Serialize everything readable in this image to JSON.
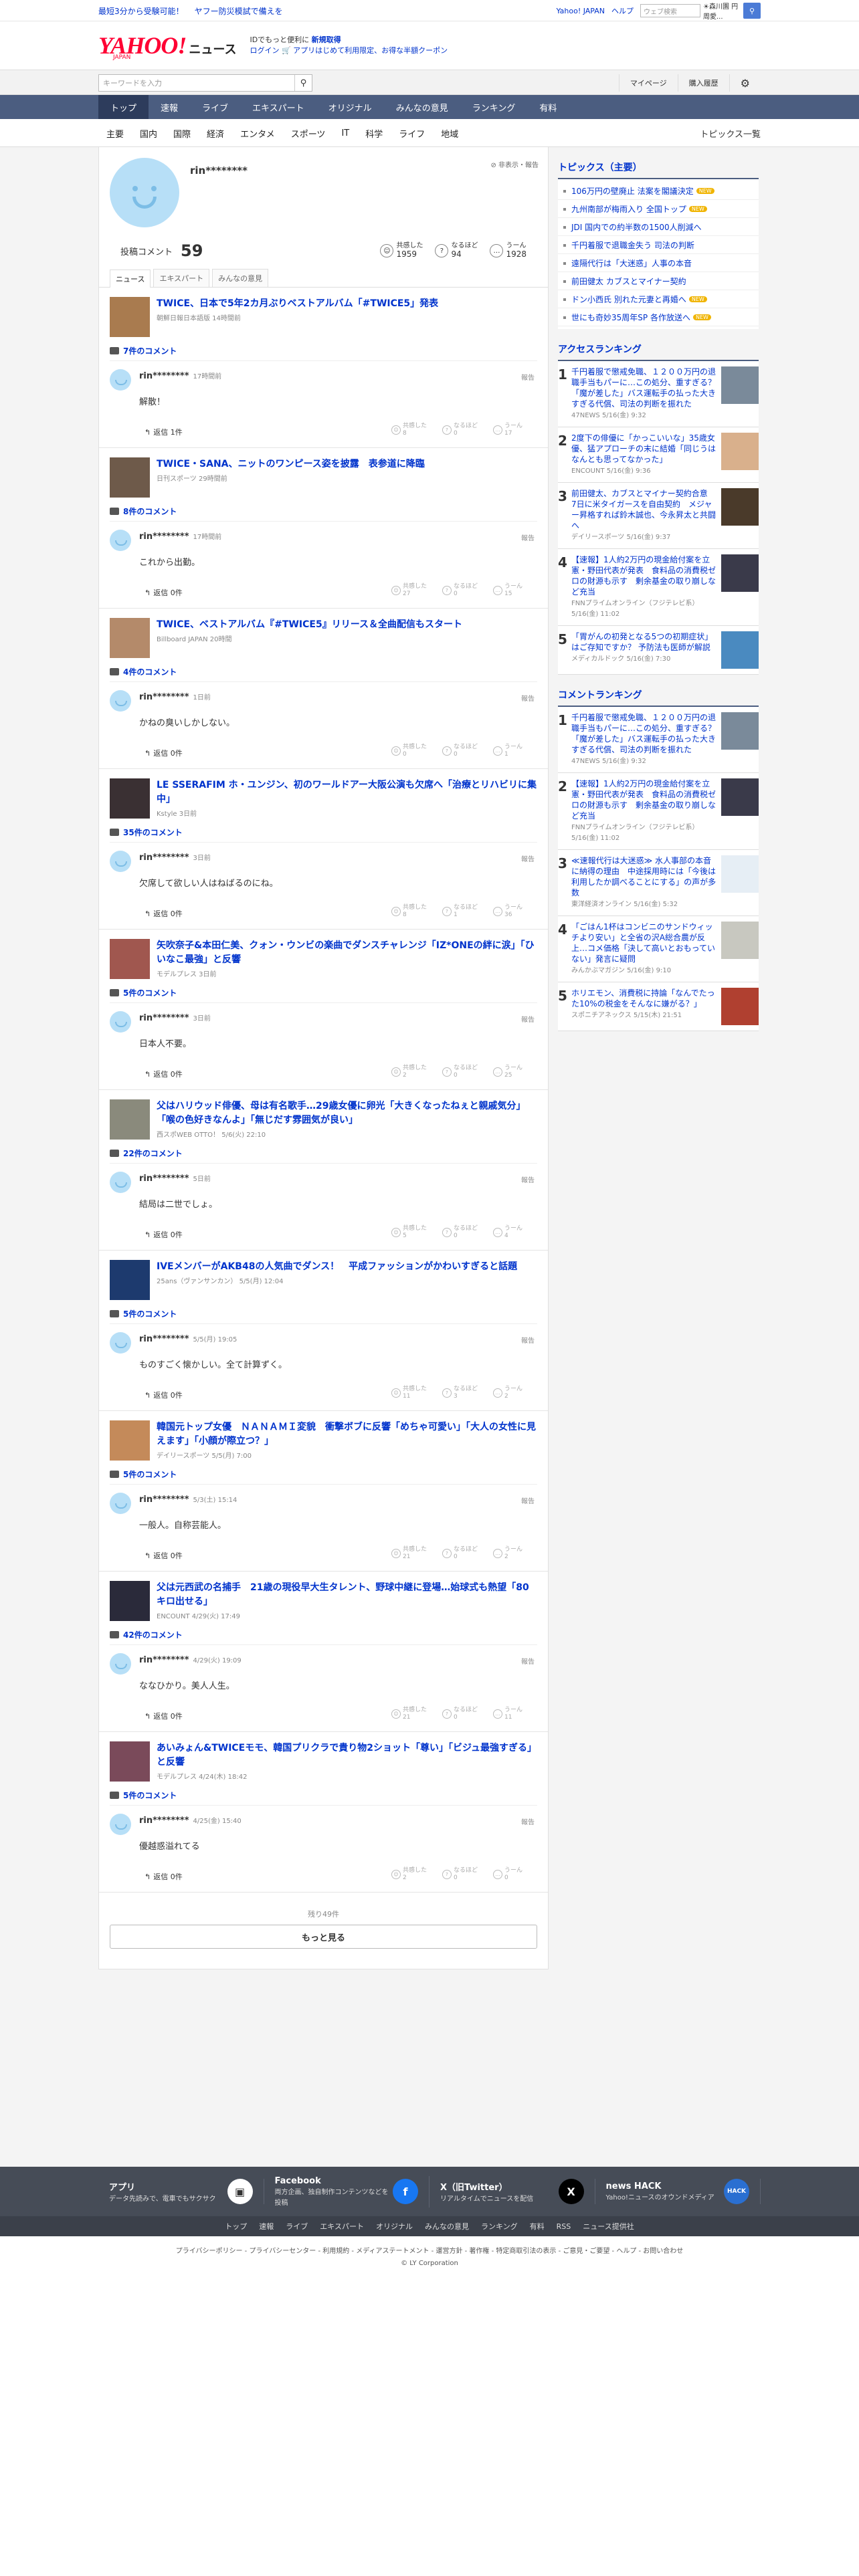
{
  "promo": {
    "left1": "最短3分から受験可能！",
    "left2": "ヤフー防災模試で備えを",
    "links": [
      "Yahoo! JAPAN",
      "ヘルプ"
    ],
    "search_placeholder": "ウェブ検索",
    "location": "☀森川園 円周愛...",
    "search_icon": "search-icon"
  },
  "header": {
    "logo": "YAHOO!",
    "logo_sub": "JAPAN",
    "section": "ニュース",
    "line1_pre": "IDでもっと便利に",
    "line1_link": "新規取得",
    "line2": "ログイン 🛒 アプリはじめて利用限定、お得な半額クーポン"
  },
  "search": {
    "placeholder": "キーワードを入力",
    "mypage": "マイページ",
    "history": "購入履歴"
  },
  "nav": {
    "items": [
      "トップ",
      "速報",
      "ライブ",
      "エキスパート",
      "オリジナル",
      "みんなの意見",
      "ランキング",
      "有料"
    ]
  },
  "subnav": {
    "items": [
      "主要",
      "国内",
      "国際",
      "経済",
      "エンタメ",
      "スポーツ",
      "IT",
      "科学",
      "ライフ",
      "地域"
    ],
    "more": "トピックス一覧"
  },
  "profile": {
    "name": "rin********",
    "hide": "非表示・報告",
    "posts_label": "投稿コメント",
    "posts": "59",
    "reactions": [
      {
        "label": "共感した",
        "count": "1959"
      },
      {
        "label": "なるほど",
        "count": "94"
      },
      {
        "label": "うーん",
        "count": "1928"
      }
    ],
    "tabs": [
      "ニュース",
      "エキスパート",
      "みんなの意見"
    ]
  },
  "comments": [
    {
      "title": "TWICE、日本で5年2カ月ぶりベストアルバム「#TWICE5」発表",
      "source": "朝鮮日報日本語版 14時間前",
      "count": "7件のコメント",
      "time": "17時間前",
      "body": "解散！",
      "replies": "返信 1件",
      "r1": "8",
      "r2": "0",
      "r3": "17",
      "thumb": "#a97b4f"
    },
    {
      "title": "TWICE・SANA、ニットのワンピース姿を披露　表参道に降臨",
      "source": "日刊スポーツ 29時間前",
      "count": "8件のコメント",
      "time": "17時間前",
      "body": "これから出勤。",
      "replies": "返信 0件",
      "r1": "27",
      "r2": "0",
      "r3": "15",
      "thumb": "#6e5a4a"
    },
    {
      "title": "TWICE、ベストアルバム『#TWICE5』リリース＆全曲配信もスタート",
      "source": "Billboard JAPAN 20時間",
      "count": "4件のコメント",
      "time": "1日前",
      "body": "かねの臭いしかしない。",
      "replies": "返信 0件",
      "r1": "0",
      "r2": "0",
      "r3": "1",
      "thumb": "#b48a6a"
    },
    {
      "title": "LE SSERAFIM ホ・ユンジン、初のワールドアー大阪公演も欠席へ「治療とリハビリに集中」",
      "source": "Kstyle 3日前",
      "count": "35件のコメント",
      "time": "3日前",
      "body": "欠席して欲しい人はねばるのにね。",
      "replies": "返信 0件",
      "r1": "8",
      "r2": "1",
      "r3": "36",
      "thumb": "#3a3033"
    },
    {
      "title": "矢吹奈子&本田仁美、クォン・ウンビの楽曲でダンスチャレンジ「IZ*ONEの絆に涙」「ひいなこ最強」と反響",
      "source": "モデルプレス 3日前",
      "count": "5件のコメント",
      "time": "3日前",
      "body": "日本人不要。",
      "replies": "返信 0件",
      "r1": "2",
      "r2": "0",
      "r3": "25",
      "thumb": "#a0574f"
    },
    {
      "title": "父はハリウッド俳優、母は有名歌手…29歳女優に卵光「大きくなったねぇと親戚気分」「喉の色好きなんよ」「無じだす雰囲気が良い」",
      "source": "西スポWEB OTTO！ 5/6(火) 22:10",
      "count": "22件のコメント",
      "time": "5日前",
      "body": "結局は二世でしょ。",
      "replies": "返信 0件",
      "r1": "5",
      "r2": "0",
      "r3": "4",
      "thumb": "#8a8a7c"
    },
    {
      "title": "IVEメンバーがAKB48の人気曲でダンス！　平成ファッションがかわいすぎると話題",
      "source": "25ans（ヴァンサンカン） 5/5(月) 12:04",
      "count": "5件のコメント",
      "time": "5/5(月) 19:05",
      "body": "ものすごく懐かしい。全て計算ずく。",
      "replies": "返信 0件",
      "r1": "11",
      "r2": "3",
      "r3": "2",
      "thumb": "#1d3a6e"
    },
    {
      "title": "韓国元トップ女優　ＮＡＮＡＭＩ変貌　衝撃ボブに反響「めちゃ可愛い」「大人の女性に見えます」「小顔が際立つ？」",
      "source": "デイリースポーツ 5/5(月) 7:00",
      "count": "5件のコメント",
      "time": "5/3(土) 15:14",
      "body": "一般人。自称芸能人。",
      "replies": "返信 0件",
      "r1": "21",
      "r2": "0",
      "r3": "2",
      "thumb": "#c48a5a"
    },
    {
      "title": "父は元西武の名捕手　21歳の現役早大生タレント、野球中継に登場…始球式も熱望「80キロ出せる」",
      "source": "ENCOUNT 4/29(火) 17:49",
      "count": "42件のコメント",
      "time": "4/29(火) 19:09",
      "body": "ななひかり。美人人生。",
      "replies": "返信 0件",
      "r1": "21",
      "r2": "0",
      "r3": "11",
      "thumb": "#2a2a3a"
    },
    {
      "title": "あいみょん&TWICEモモ、韓国プリクラで貴り物2ショット「尊い」「ビジュ最強すぎる」と反響",
      "source": "モデルプレス 4/24(木) 18:42",
      "count": "5件のコメント",
      "time": "4/25(金) 15:40",
      "body": "優越惑溢れてる",
      "replies": "返信 0件",
      "r1": "2",
      "r2": "0",
      "r3": "0",
      "thumb": "#7a4a5a"
    }
  ],
  "more": {
    "remaining": "残り49件",
    "button": "もっと見る"
  },
  "sidebar": {
    "topics_title": "トピックス（主要）",
    "topics": [
      {
        "t": "106万円の壁廃止 法案を閣議決定",
        "new": "NEW"
      },
      {
        "t": "九州南部が梅雨入り 全国トップ",
        "new": "NEW"
      },
      {
        "t": "JDI 国内での約半数の1500人削減へ",
        "new": ""
      },
      {
        "t": "千円着服で退職金失う 司法の判断",
        "new": ""
      },
      {
        "t": "遠隔代行は「大迷惑」人事の本音",
        "new": ""
      },
      {
        "t": "前田健太 カブスとマイナー契約",
        "new": ""
      },
      {
        "t": "ドン小西氏 別れた元妻と再婚へ",
        "new": "NEW"
      },
      {
        "t": "世にも奇妙35周年SP 各作放送へ",
        "new": "NEW"
      }
    ],
    "access_title": "アクセスランキング",
    "access": [
      {
        "t": "千円着服で懲戒免職、１２００万円の退職手当もパーに…この処分、重すぎる？「魔が差した」バス運転手の払った大きすぎる代償、司法の判断を振れた",
        "s": "47NEWS 5/16(金) 9:32",
        "c": "#7a8a9a"
      },
      {
        "t": "2度下の俳優に「かっこいいな」35歳女優、猛アプローチの末に結婚「同じうはなんとも思ってなかった」",
        "s": "ENCOUNT 5/16(金) 9:36",
        "c": "#d9b08c"
      },
      {
        "t": "前田健太、カブスとマイナー契約合意　7日に米タイガースを自由契約　メジャー昇格すれば鈴木誠也、今永昇太と共闘へ",
        "s": "デイリースポーツ 5/16(金) 9:37",
        "c": "#4a3a2a"
      },
      {
        "t": "【速報】1人約2万円の現金給付案を立憲・野田代表が発表　食料品の消費税ゼロの財源も示す　剰余基金の取り崩しなど充当",
        "s": "FNNプライムオンライン（フジテレビ系） 5/16(金) 11:02",
        "c": "#3a3a4a"
      },
      {
        "t": "「胃がんの初発となる5つの初期症状」はご存知ですか？ 予防法も医師が解説",
        "s": "メディカルドック 5/16(金) 7:30",
        "c": "#4a8ac0"
      }
    ],
    "comment_title": "コメントランキング",
    "cranking": [
      {
        "t": "千円着服で懲戒免職、１２００万円の退職手当もパーに…この処分、重すぎる？「魔が差した」バス運転手の払った大きすぎる代償、司法の判断を振れた",
        "s": "47NEWS 5/16(金) 9:32",
        "c": "#7a8a9a"
      },
      {
        "t": "【速報】1人約2万円の現金給付案を立憲・野田代表が発表　食料品の消費税ゼロの財源も示す　剰余基金の取り崩しなど充当",
        "s": "FNNプライムオンライン（フジテレビ系） 5/16(金) 11:02",
        "c": "#3a3a4a"
      },
      {
        "t": "≪速報代行は大迷惑≫ 水人事部の本音に納得の理由　中途採用時には「今後は利用したか調べることにする」の声が多数",
        "s": "東洋経済オンライン 5/16(金) 5:32",
        "c": "#e6eef5"
      },
      {
        "t": "「ごはん1杯はコンビニのサンドウィッチより安い」と全省の沢A総合農が反上…コメ価格「決して高いとおもっていない」発言に疑問",
        "s": "みんかぶマガジン 5/16(金) 9:10",
        "c": "#c8c8c0"
      },
      {
        "t": "ホリエモン、消費税に持論「なんでたった10%の税金をそんなに嫌がる？」",
        "s": "スポニチアネックス 5/15(木) 21:51",
        "c": "#b04030"
      }
    ]
  },
  "footer": {
    "cols": [
      {
        "title": "アプリ",
        "desc": "データ先読みで、電車でもサクサク",
        "icon": "app-icon"
      },
      {
        "title": "Facebook",
        "desc": "両方企画、独自制作コンテンツなどを投稿",
        "icon": "f"
      },
      {
        "title": "X（旧Twitter）",
        "desc": "リアルタイムでニュースを配信",
        "icon": "X"
      },
      {
        "title": "news HACK",
        "desc": "Yahoo!ニュースのオウンドメディア",
        "icon": "HACK"
      }
    ],
    "nav": [
      "トップ",
      "速報",
      "ライブ",
      "エキスパート",
      "オリジナル",
      "みんなの意見",
      "ランキング",
      "有料",
      "RSS",
      "ニュース提供社"
    ],
    "legal": "プライバシーポリシー - プライバシーセンター - 利用規約 - メディアステートメント - 運営方針 - 著作権 - 特定商取引法の表示 - ご意見・ご要望 - ヘルプ - お問い合わせ",
    "copy": "© LY Corporation"
  }
}
